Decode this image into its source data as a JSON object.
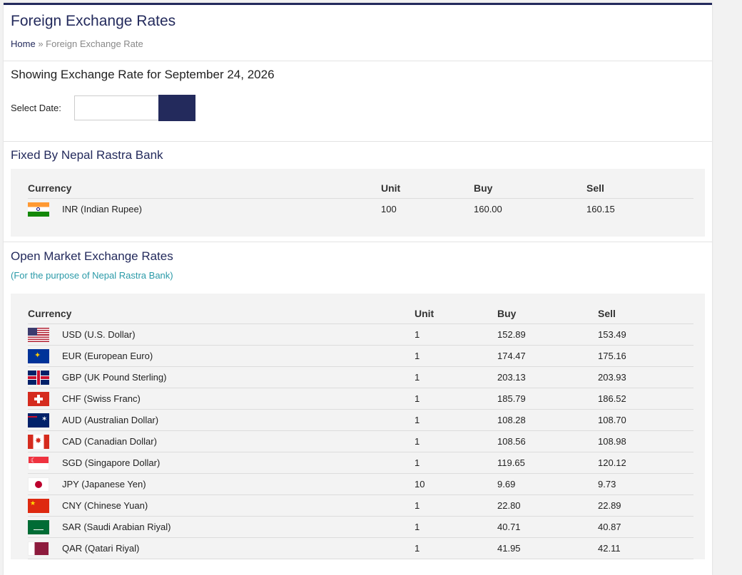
{
  "header": {
    "title": "Foreign Exchange Rates",
    "breadcrumb": {
      "home": "Home",
      "separator": "»",
      "current": "Foreign Exchange Rate"
    }
  },
  "date_section": {
    "heading": "Showing Exchange Rate for September 24, 2026",
    "label": "Select Date:",
    "input_value": ""
  },
  "fixed_section": {
    "heading": "Fixed By Nepal Rastra Bank",
    "columns": {
      "currency": "Currency",
      "unit": "Unit",
      "buy": "Buy",
      "sell": "Sell"
    },
    "rows": [
      {
        "flag": "india-flag-icon",
        "currency": "INR (Indian Rupee)",
        "unit": "100",
        "buy": "160.00",
        "sell": "160.15"
      }
    ]
  },
  "open_market": {
    "heading": "Open Market Exchange Rates",
    "subheading": "(For the purpose of Nepal Rastra Bank)",
    "columns": {
      "currency": "Currency",
      "unit": "Unit",
      "buy": "Buy",
      "sell": "Sell"
    },
    "rows": [
      {
        "flag": "usa-flag-icon",
        "currency": "USD (U.S. Dollar)",
        "unit": "1",
        "buy": "152.89",
        "sell": "153.49"
      },
      {
        "flag": "eu-flag-icon",
        "currency": "EUR (European Euro)",
        "unit": "1",
        "buy": "174.47",
        "sell": "175.16"
      },
      {
        "flag": "uk-flag-icon",
        "currency": "GBP (UK Pound Sterling)",
        "unit": "1",
        "buy": "203.13",
        "sell": "203.93"
      },
      {
        "flag": "switzerland-flag-icon",
        "currency": "CHF (Swiss Franc)",
        "unit": "1",
        "buy": "185.79",
        "sell": "186.52"
      },
      {
        "flag": "australia-flag-icon",
        "currency": "AUD (Australian Dollar)",
        "unit": "1",
        "buy": "108.28",
        "sell": "108.70"
      },
      {
        "flag": "canada-flag-icon",
        "currency": "CAD (Canadian Dollar)",
        "unit": "1",
        "buy": "108.56",
        "sell": "108.98"
      },
      {
        "flag": "singapore-flag-icon",
        "currency": "SGD (Singapore Dollar)",
        "unit": "1",
        "buy": "119.65",
        "sell": "120.12"
      },
      {
        "flag": "japan-flag-icon",
        "currency": "JPY (Japanese Yen)",
        "unit": "10",
        "buy": "9.69",
        "sell": "9.73"
      },
      {
        "flag": "china-flag-icon",
        "currency": "CNY (Chinese Yuan)",
        "unit": "1",
        "buy": "22.80",
        "sell": "22.89"
      },
      {
        "flag": "saudi-arabia-flag-icon",
        "currency": "SAR (Saudi Arabian Riyal)",
        "unit": "1",
        "buy": "40.71",
        "sell": "40.87"
      },
      {
        "flag": "qatar-flag-icon",
        "currency": "QAR (Qatari Riyal)",
        "unit": "1",
        "buy": "41.95",
        "sell": "42.11"
      }
    ]
  },
  "colors": {
    "brand_navy": "#232a5c",
    "subheading_teal": "#2a9aa8"
  }
}
